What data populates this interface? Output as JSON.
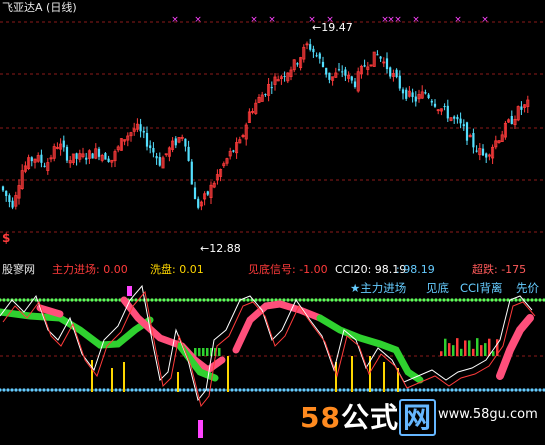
{
  "header": {
    "title": "飞亚达A (日线)"
  },
  "price_chart": {
    "high_label": "19.47",
    "low_label": "12.88",
    "buy_marker": "$",
    "top_marker": "×"
  },
  "indicator": {
    "name": "股寥网",
    "items": [
      {
        "label": "主力进场:",
        "value": "0.00",
        "color": "#ff3b3b"
      },
      {
        "label": "洗盘:",
        "value": "0.01",
        "color": "#ffd700"
      },
      {
        "label": "见底信号:",
        "value": "-1.00",
        "color": "#ff3b3b"
      },
      {
        "label": "CCI20:",
        "value": "98.19",
        "color": "#ffffff"
      },
      {
        "label": ":",
        "value": "98.19",
        "color": "#66ccff"
      },
      {
        "label": "超跌:",
        "value": "-175",
        "color": "#ff5a5a"
      }
    ],
    "legend": [
      "★主力进场",
      "见底",
      "CCI背离",
      "先价"
    ]
  },
  "watermark": {
    "num": "58",
    "text": "公式",
    "framed": "网",
    "url": "www.58gu.com"
  },
  "colors": {
    "up": "#ff3b3b",
    "down": "#54e0ff",
    "grid": "#8b1a1a",
    "ma_green": "#2fd12f",
    "ma_pink": "#ff4f7b"
  },
  "chart_data": {
    "type": "candlestick",
    "title": "飞亚达A (日线)",
    "annotations": [
      {
        "text": "19.47",
        "kind": "high"
      },
      {
        "text": "12.88",
        "kind": "low"
      }
    ],
    "y_range_price": [
      12.0,
      20.2
    ]
  }
}
